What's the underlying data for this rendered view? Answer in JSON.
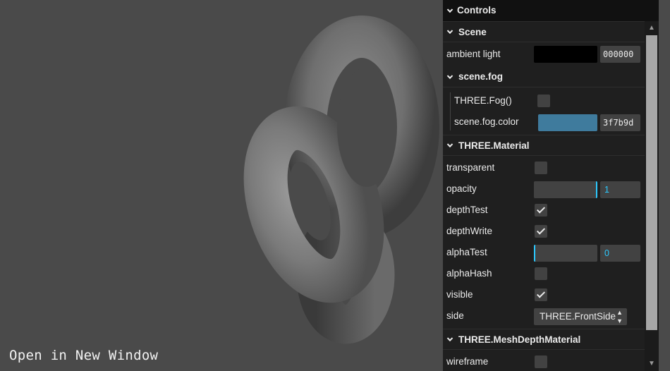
{
  "link": {
    "open_in_new_window": "Open in New Window"
  },
  "gui": {
    "title": "Controls",
    "scene": {
      "title": "Scene",
      "ambient_light": {
        "label": "ambient light",
        "color": "#000000",
        "hex": "000000"
      },
      "fog": {
        "title": "scene.fog",
        "three_fog": {
          "label": "THREE.Fog()",
          "checked": false
        },
        "fog_color": {
          "label": "scene.fog.color",
          "color": "#3f7b9d",
          "hex": "3f7b9d"
        }
      }
    },
    "material": {
      "title": "THREE.Material",
      "transparent": {
        "label": "transparent",
        "checked": false
      },
      "opacity": {
        "label": "opacity",
        "value": "1",
        "fraction": 1.0
      },
      "depthTest": {
        "label": "depthTest",
        "checked": true
      },
      "depthWrite": {
        "label": "depthWrite",
        "checked": true
      },
      "alphaTest": {
        "label": "alphaTest",
        "value": "0",
        "fraction": 0.0
      },
      "alphaHash": {
        "label": "alphaHash",
        "checked": false
      },
      "visible": {
        "label": "visible",
        "checked": true
      },
      "side": {
        "label": "side",
        "value": "THREE.FrontSide"
      }
    },
    "depth_material": {
      "title": "THREE.MeshDepthMaterial",
      "wireframe": {
        "label": "wireframe",
        "checked": false
      }
    }
  },
  "colors": {
    "viewport_bg": "#4a4a4a",
    "gui_bg": "#1f1f1f",
    "accent": "#2cc9ff"
  }
}
